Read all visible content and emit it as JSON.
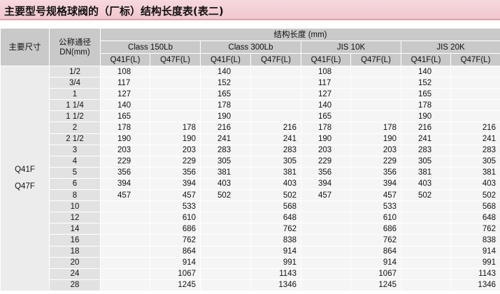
{
  "title": "主要型号规格球阀的（厂标）结构长度表(表二)",
  "header": {
    "main_size": "主要尺寸",
    "dn_line1": "公称通径",
    "dn_line2": "DN(mm)",
    "struct_len": "结构长度 (mm)",
    "groups": [
      "Class 150Lb",
      "Class 300Lb",
      "JIS 10K",
      "JIS 20K"
    ],
    "sub": [
      "Q41F(L)",
      "Q47F(L)",
      "Q41F(L)",
      "Q47F(L)",
      "Q41F(L)",
      "Q47F(L)",
      "Q41F(L)",
      "Q47F(L)"
    ]
  },
  "spec_labels": [
    "Q41F",
    "Q47F"
  ],
  "rows": [
    {
      "dn": "1/2",
      "v": [
        "108",
        "",
        "140",
        "",
        "108",
        "",
        "140",
        ""
      ]
    },
    {
      "dn": "3/4",
      "v": [
        "117",
        "",
        "152",
        "",
        "117",
        "",
        "152",
        ""
      ]
    },
    {
      "dn": "1",
      "v": [
        "127",
        "",
        "165",
        "",
        "127",
        "",
        "165",
        ""
      ]
    },
    {
      "dn": "1 1/4",
      "v": [
        "140",
        "",
        "178",
        "",
        "140",
        "",
        "178",
        ""
      ]
    },
    {
      "dn": "1 1/2",
      "v": [
        "165",
        "",
        "190",
        "",
        "165",
        "",
        "190",
        ""
      ]
    },
    {
      "dn": "2",
      "v": [
        "178",
        "178",
        "216",
        "216",
        "178",
        "178",
        "216",
        "216"
      ]
    },
    {
      "dn": "2 1/2",
      "v": [
        "190",
        "190",
        "241",
        "241",
        "190",
        "190",
        "241",
        "241"
      ]
    },
    {
      "dn": "3",
      "v": [
        "203",
        "203",
        "283",
        "283",
        "203",
        "203",
        "283",
        "283"
      ]
    },
    {
      "dn": "4",
      "v": [
        "229",
        "229",
        "305",
        "305",
        "229",
        "229",
        "305",
        "305"
      ]
    },
    {
      "dn": "5",
      "v": [
        "356",
        "356",
        "381",
        "381",
        "356",
        "356",
        "381",
        "381"
      ]
    },
    {
      "dn": "6",
      "v": [
        "394",
        "394",
        "403",
        "403",
        "394",
        "394",
        "403",
        "403"
      ]
    },
    {
      "dn": "8",
      "v": [
        "457",
        "457",
        "502",
        "502",
        "457",
        "457",
        "502",
        "502"
      ]
    },
    {
      "dn": "10",
      "v": [
        "",
        "533",
        "",
        "568",
        "",
        "533",
        "",
        "568"
      ]
    },
    {
      "dn": "12",
      "v": [
        "",
        "610",
        "",
        "648",
        "",
        "610",
        "",
        "648"
      ]
    },
    {
      "dn": "14",
      "v": [
        "",
        "686",
        "",
        "762",
        "",
        "686",
        "",
        "762"
      ]
    },
    {
      "dn": "16",
      "v": [
        "",
        "762",
        "",
        "838",
        "",
        "762",
        "",
        "838"
      ]
    },
    {
      "dn": "18",
      "v": [
        "",
        "864",
        "",
        "914",
        "",
        "864",
        "",
        "914"
      ]
    },
    {
      "dn": "20",
      "v": [
        "",
        "914",
        "",
        "991",
        "",
        "914",
        "",
        "991"
      ]
    },
    {
      "dn": "24",
      "v": [
        "",
        "1067",
        "",
        "1143",
        "",
        "1067",
        "",
        "1143"
      ]
    },
    {
      "dn": "28",
      "v": [
        "",
        "1245",
        "",
        "1346",
        "",
        "1245",
        "",
        "1346"
      ]
    }
  ]
}
